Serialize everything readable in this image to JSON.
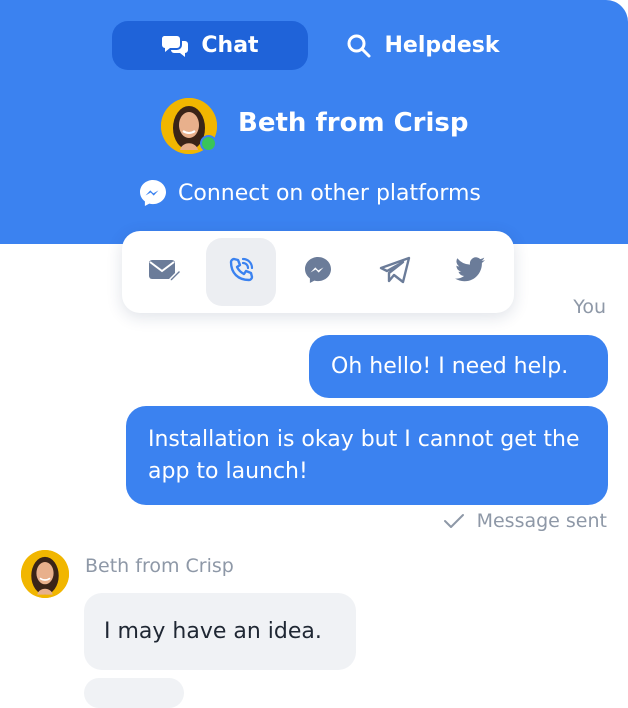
{
  "header": {
    "tabs": [
      {
        "label": "Chat",
        "icon": "chat-bubbles-icon",
        "active": true
      },
      {
        "label": "Helpdesk",
        "icon": "search-icon",
        "active": false
      }
    ],
    "agent": {
      "name": "Beth from Crisp",
      "status": "online"
    },
    "connect_label": "Connect on other platforms",
    "connect_icon": "messenger-icon"
  },
  "platforms": [
    {
      "icon": "email-icon",
      "active": false
    },
    {
      "icon": "phone-icon",
      "active": true
    },
    {
      "icon": "messenger-icon",
      "active": false
    },
    {
      "icon": "telegram-icon",
      "active": false
    },
    {
      "icon": "twitter-icon",
      "active": false
    }
  ],
  "conversation": {
    "you_label": "You",
    "outgoing": [
      "Oh hello! I need help.",
      "Installation is okay but I cannot get the app to launch!"
    ],
    "status": "Message sent",
    "incoming_sender": "Beth from Crisp",
    "incoming": [
      "I may have an idea."
    ]
  },
  "colors": {
    "brand": "#3b82f0",
    "tab_active": "#1f63d9",
    "online": "#39c45a",
    "muted": "#8e98a7"
  }
}
